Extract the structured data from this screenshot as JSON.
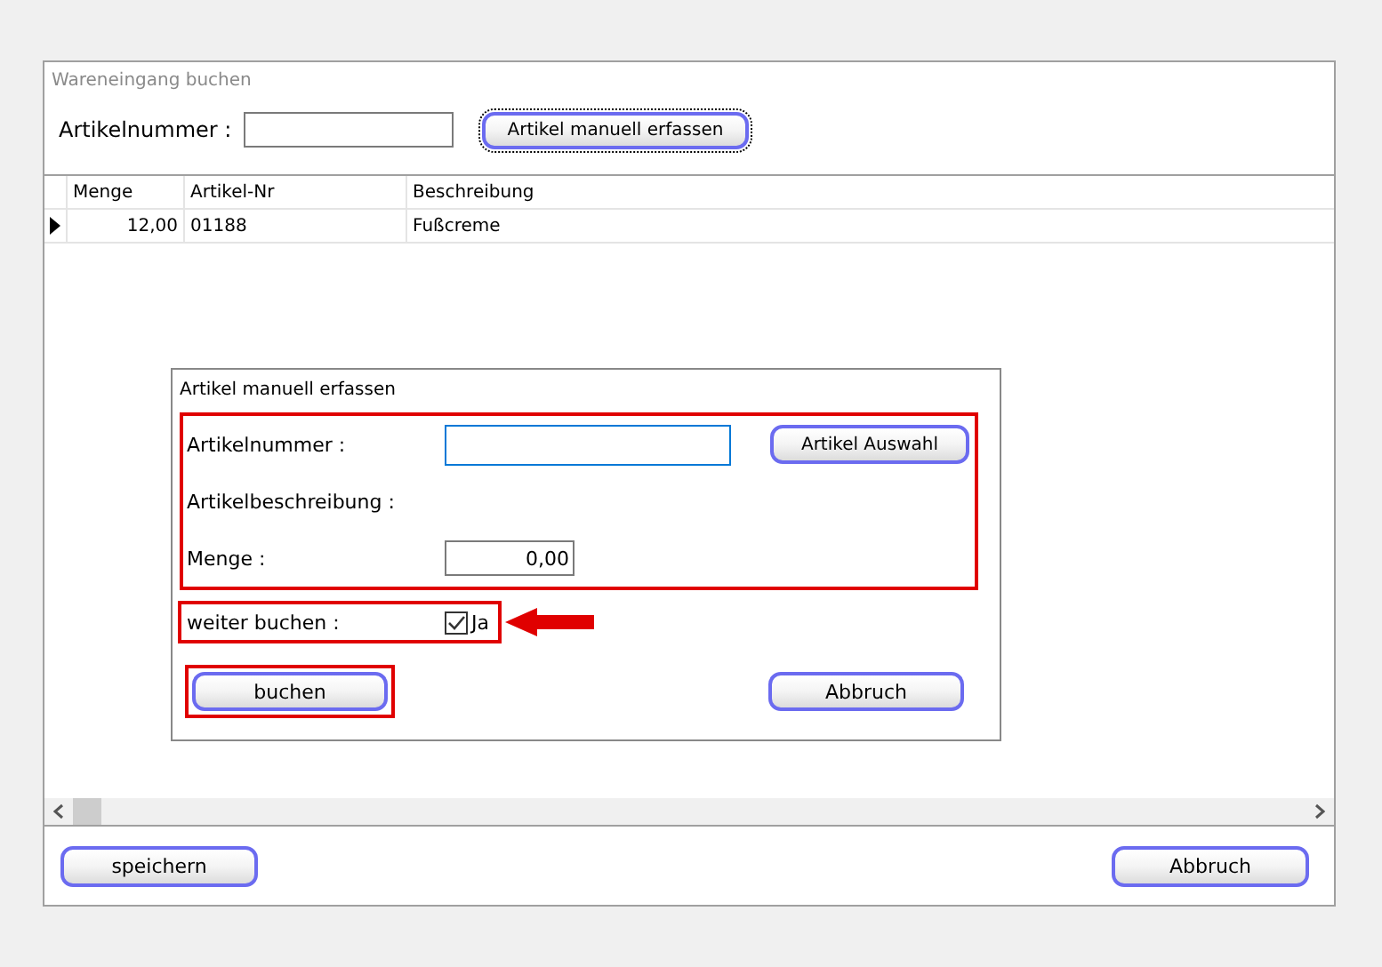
{
  "window": {
    "title": "Wareneingang buchen"
  },
  "search": {
    "label": "Artikelnummer :"
  },
  "manual_button": {
    "label": "Artikel manuell erfassen",
    "focused": true
  },
  "table": {
    "columns": [
      "Menge",
      "Artikel-Nr",
      "Beschreibung"
    ],
    "rows": [
      {
        "selected": true,
        "cells": [
          "12,00",
          "01188",
          "Fußcreme"
        ]
      }
    ]
  },
  "dialog": {
    "title": "Artikel manuell erfassen",
    "highlighted": true,
    "fields": [
      {
        "kind": "text",
        "label": "Artikelnummer :",
        "focused": true
      },
      {
        "kind": "static",
        "label": "Artikelbeschreibung :"
      },
      {
        "kind": "number",
        "label": "Menge :",
        "value": "0,00"
      }
    ],
    "lookup_button": "Artikel Auswahl",
    "option": {
      "label": "weiter buchen :",
      "checkbox_label": "Ja",
      "checked": true,
      "highlighted": true,
      "arrow": true
    },
    "buttons": [
      {
        "label": "buchen",
        "highlighted": true
      },
      {
        "label": "Abbruch",
        "highlighted": false
      }
    ]
  },
  "footer_buttons": [
    "speichern",
    "Abbruch"
  ]
}
